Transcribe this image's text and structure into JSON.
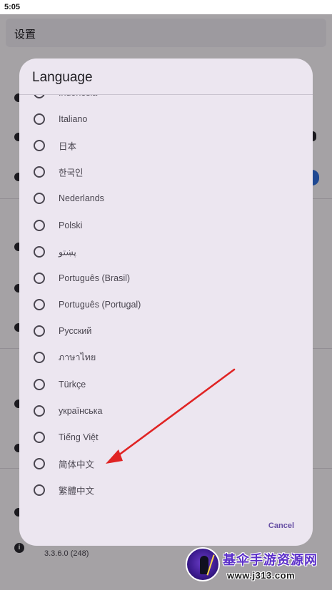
{
  "status_bar": {
    "time": "5:05"
  },
  "background": {
    "settings_title": "设置",
    "version_text": "3.3.6.0 (248)",
    "info_glyph": "i",
    "accent_color": "#2e6bd8"
  },
  "dialog": {
    "title": "Language",
    "cancel_label": "Cancel",
    "accent_color": "#6750a4",
    "languages": [
      {
        "label": "Indonesia",
        "selected": false
      },
      {
        "label": "Italiano",
        "selected": false
      },
      {
        "label": "日本",
        "selected": false
      },
      {
        "label": "한국인",
        "selected": false
      },
      {
        "label": "Nederlands",
        "selected": false
      },
      {
        "label": "Polski",
        "selected": false
      },
      {
        "label": "پښتو",
        "selected": false
      },
      {
        "label": "Português (Brasil)",
        "selected": false
      },
      {
        "label": "Português (Portugal)",
        "selected": false
      },
      {
        "label": "Русский",
        "selected": false
      },
      {
        "label": "ภาษาไทย",
        "selected": false
      },
      {
        "label": "Türkçe",
        "selected": false
      },
      {
        "label": "українська",
        "selected": false
      },
      {
        "label": "Tiếng Việt",
        "selected": false
      },
      {
        "label": "简体中文",
        "selected": false
      },
      {
        "label": "繁體中文",
        "selected": false
      }
    ]
  },
  "annotation": {
    "arrow_color": "#e02424",
    "target": "简体中文"
  },
  "watermark": {
    "title": "基伞手游资源网",
    "url": "www.j313.com"
  }
}
